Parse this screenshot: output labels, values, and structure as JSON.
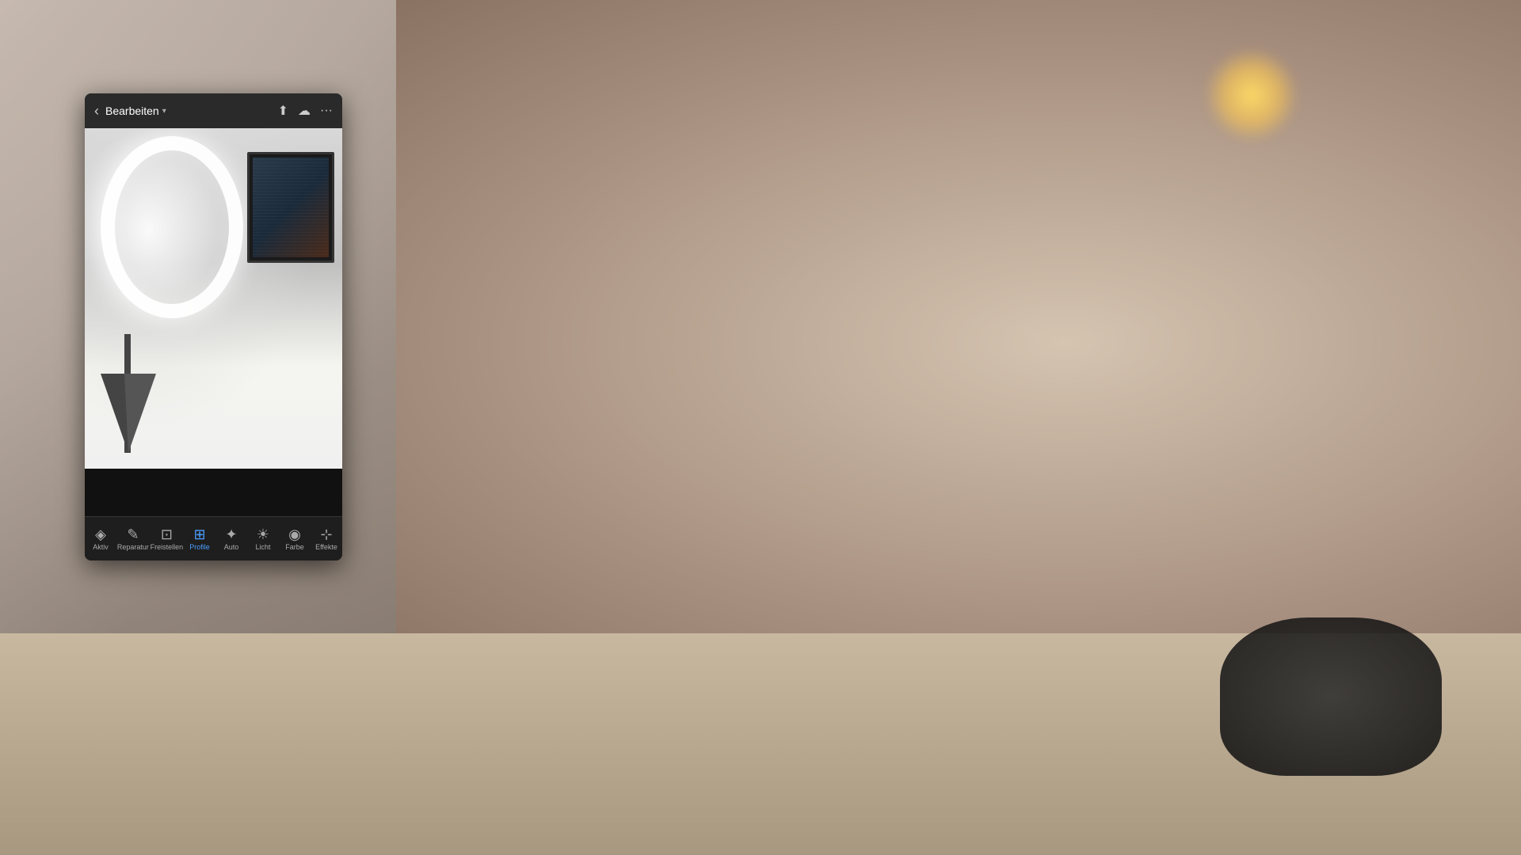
{
  "scene": {
    "bg_color": "#a08878"
  },
  "phone": {
    "topbar": {
      "back_label": "‹",
      "title": "Bearbeiten",
      "dropdown_arrow": "▾",
      "share_icon": "⬆",
      "cloud_icon": "☁",
      "more_icon": "···"
    },
    "toolbar": {
      "items": [
        {
          "id": "aktiv",
          "label": "Aktiv",
          "icon": "◈",
          "active": false
        },
        {
          "id": "reparatur",
          "label": "Reparatur",
          "icon": "✎",
          "active": false
        },
        {
          "id": "freistellen",
          "label": "Freistellen",
          "icon": "⊡",
          "active": false
        },
        {
          "id": "profile",
          "label": "Profile",
          "icon": "⊞",
          "active": true
        },
        {
          "id": "auto",
          "label": "Auto",
          "icon": "✦",
          "active": false
        },
        {
          "id": "licht",
          "label": "Licht",
          "icon": "☀",
          "active": false
        },
        {
          "id": "farbe",
          "label": "Farbe",
          "icon": "◉",
          "active": false
        },
        {
          "id": "effekte",
          "label": "Effekte",
          "icon": "⊹",
          "active": false
        }
      ]
    }
  }
}
